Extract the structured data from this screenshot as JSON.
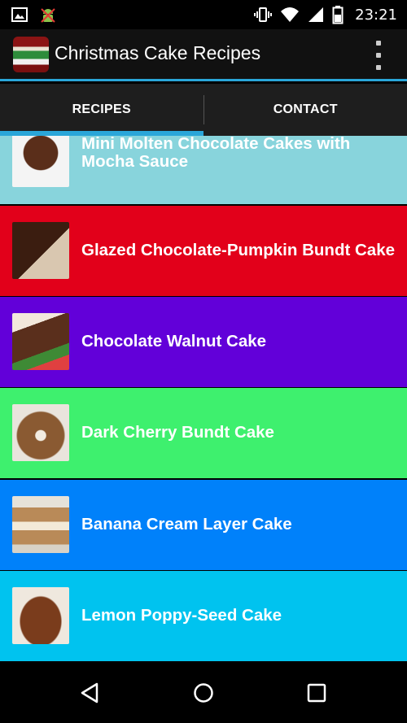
{
  "status_bar": {
    "time": "23:21",
    "icons": [
      "image-icon",
      "android-debug-icon",
      "vibrate-icon",
      "wifi-icon",
      "signal-icon",
      "battery-icon"
    ]
  },
  "action_bar": {
    "title": "Christmas Cake Recipes",
    "logo_icon": "app-logo-icon",
    "menu_icon": "overflow-menu-icon"
  },
  "tabs": [
    {
      "label": "RECIPES",
      "active": true
    },
    {
      "label": "CONTACT",
      "active": false
    }
  ],
  "colors": {
    "accent": "#2aa6d9",
    "row_colors": [
      "#88d4dc",
      "#e2001a",
      "#6200d9",
      "#3ef06e",
      "#0081fa",
      "#00c3ef"
    ]
  },
  "recipes": [
    {
      "title": "Mini Molten Chocolate Cakes with Mocha Sauce",
      "color": "#88d4dc"
    },
    {
      "title": "Glazed Chocolate-Pumpkin Bundt Cake",
      "color": "#e2001a"
    },
    {
      "title": "Chocolate Walnut Cake",
      "color": "#6200d9"
    },
    {
      "title": "Dark Cherry Bundt Cake",
      "color": "#3ef06e"
    },
    {
      "title": "Banana Cream Layer Cake",
      "color": "#0081fa"
    },
    {
      "title": "Lemon Poppy-Seed Cake",
      "color": "#00c3ef"
    }
  ],
  "nav_bar": {
    "icons": [
      "back-icon",
      "home-icon",
      "recents-icon"
    ]
  }
}
